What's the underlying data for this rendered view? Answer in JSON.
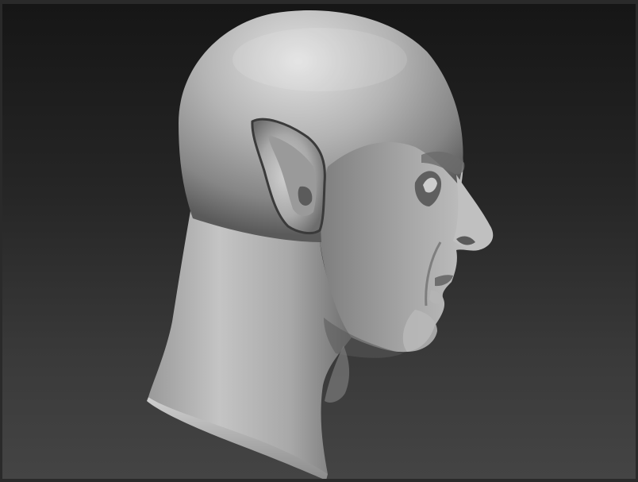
{
  "viewport": {
    "subject": "sculpted-bald-head-profile",
    "material_colors": {
      "highlight": "#d6d6d6",
      "midtone": "#9e9e9e",
      "shadow": "#4a4a4a",
      "background_top": "#161616",
      "background_bottom": "#444444"
    }
  }
}
